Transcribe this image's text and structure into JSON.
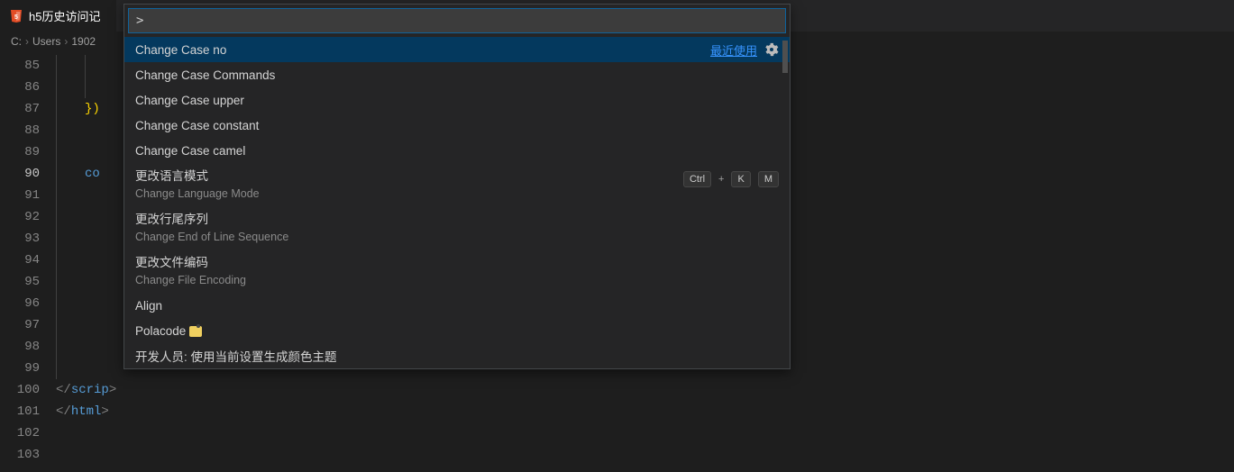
{
  "tab": {
    "label": "h5历史访问记"
  },
  "breadcrumbs": {
    "c0": "C:",
    "c1": "Users",
    "c2": "1902"
  },
  "gutter": {
    "l85": "85",
    "l86": "86",
    "l87": "87",
    "l88": "88",
    "l89": "89",
    "l90": "90",
    "l91": "91",
    "l92": "92",
    "l93": "93",
    "l94": "94",
    "l95": "95",
    "l96": "96",
    "l97": "97",
    "l98": "98",
    "l99": "99",
    "l100": "100",
    "l101": "101",
    "l102": "102",
    "l103": "103"
  },
  "code": {
    "l87_a": "})",
    "l90_a": "co",
    "l100_a": "</",
    "l100_b": "scrip",
    "l100_c": ">",
    "l101_a": "</",
    "l101_b": "html",
    "l101_c": ">"
  },
  "palette": {
    "input_value": ">",
    "recent": "最近使用",
    "items": {
      "i0": {
        "label": "Change Case no"
      },
      "i1": {
        "label": "Change Case Commands"
      },
      "i2": {
        "label": "Change Case upper"
      },
      "i3": {
        "label": "Change Case constant"
      },
      "i4": {
        "label": "Change Case camel"
      },
      "i5": {
        "label": "更改语言模式",
        "sub": "Change Language Mode",
        "keys": {
          "k0": "Ctrl",
          "plus": "+",
          "k1": "K",
          "k2": "M"
        }
      },
      "i6": {
        "label": "更改行尾序列",
        "sub": "Change End of Line Sequence"
      },
      "i7": {
        "label": "更改文件编码",
        "sub": "Change File Encoding"
      },
      "i8": {
        "label": "Align"
      },
      "i9": {
        "label": "Polacode"
      },
      "i10": {
        "label": "开发人员: 使用当前设置生成颜色主题"
      }
    }
  }
}
